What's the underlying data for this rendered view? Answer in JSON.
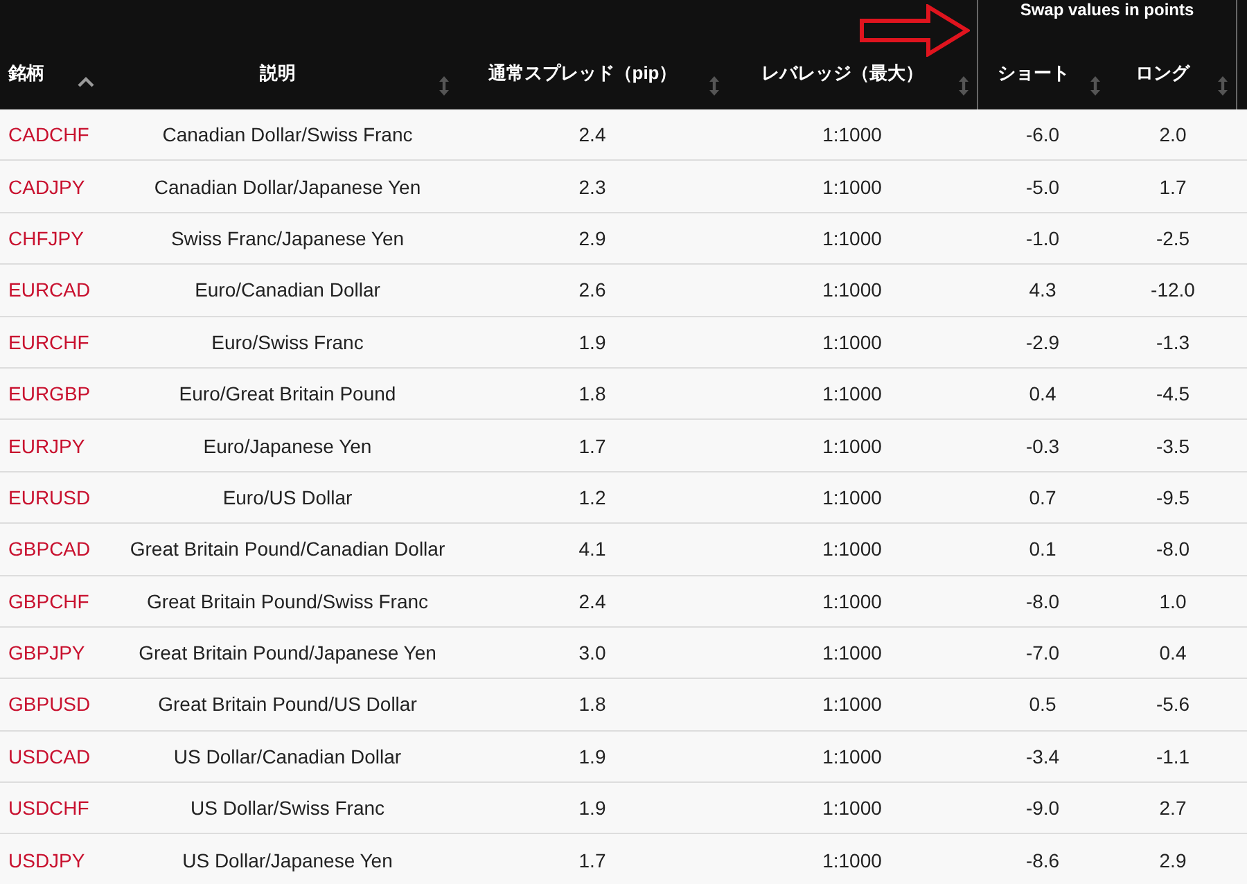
{
  "header_group": {
    "label": "Swap values in points"
  },
  "columns": [
    {
      "label": "銘柄",
      "sorted": true
    },
    {
      "label": "説明",
      "sorted": false
    },
    {
      "label": "通常スプレッド（pip）",
      "sorted": false
    },
    {
      "label": "レバレッジ（最大）",
      "sorted": false
    },
    {
      "label": "ショート",
      "sorted": false
    },
    {
      "label": "ロング",
      "sorted": false
    }
  ],
  "rows": [
    [
      "CADCHF",
      "Canadian Dollar/Swiss Franc",
      "2.4",
      "1:1000",
      "-6.0",
      "2.0"
    ],
    [
      "CADJPY",
      "Canadian Dollar/Japanese Yen",
      "2.3",
      "1:1000",
      "-5.0",
      "1.7"
    ],
    [
      "CHFJPY",
      "Swiss Franc/Japanese Yen",
      "2.9",
      "1:1000",
      "-1.0",
      "-2.5"
    ],
    [
      "EURCAD",
      "Euro/Canadian Dollar",
      "2.6",
      "1:1000",
      "4.3",
      "-12.0"
    ],
    [
      "EURCHF",
      "Euro/Swiss Franc",
      "1.9",
      "1:1000",
      "-2.9",
      "-1.3"
    ],
    [
      "EURGBP",
      "Euro/Great Britain Pound",
      "1.8",
      "1:1000",
      "0.4",
      "-4.5"
    ],
    [
      "EURJPY",
      "Euro/Japanese Yen",
      "1.7",
      "1:1000",
      "-0.3",
      "-3.5"
    ],
    [
      "EURUSD",
      "Euro/US Dollar",
      "1.2",
      "1:1000",
      "0.7",
      "-9.5"
    ],
    [
      "GBPCAD",
      "Great Britain Pound/Canadian Dollar",
      "4.1",
      "1:1000",
      "0.1",
      "-8.0"
    ],
    [
      "GBPCHF",
      "Great Britain Pound/Swiss Franc",
      "2.4",
      "1:1000",
      "-8.0",
      "1.0"
    ],
    [
      "GBPJPY",
      "Great Britain Pound/Japanese Yen",
      "3.0",
      "1:1000",
      "-7.0",
      "0.4"
    ],
    [
      "GBPUSD",
      "Great Britain Pound/US Dollar",
      "1.8",
      "1:1000",
      "0.5",
      "-5.6"
    ],
    [
      "USDCAD",
      "US Dollar/Canadian Dollar",
      "1.9",
      "1:1000",
      "-3.4",
      "-1.1"
    ],
    [
      "USDCHF",
      "US Dollar/Swiss Franc",
      "1.9",
      "1:1000",
      "-9.0",
      "2.7"
    ],
    [
      "USDJPY",
      "US Dollar/Japanese Yen",
      "1.7",
      "1:1000",
      "-8.6",
      "2.9"
    ]
  ]
}
